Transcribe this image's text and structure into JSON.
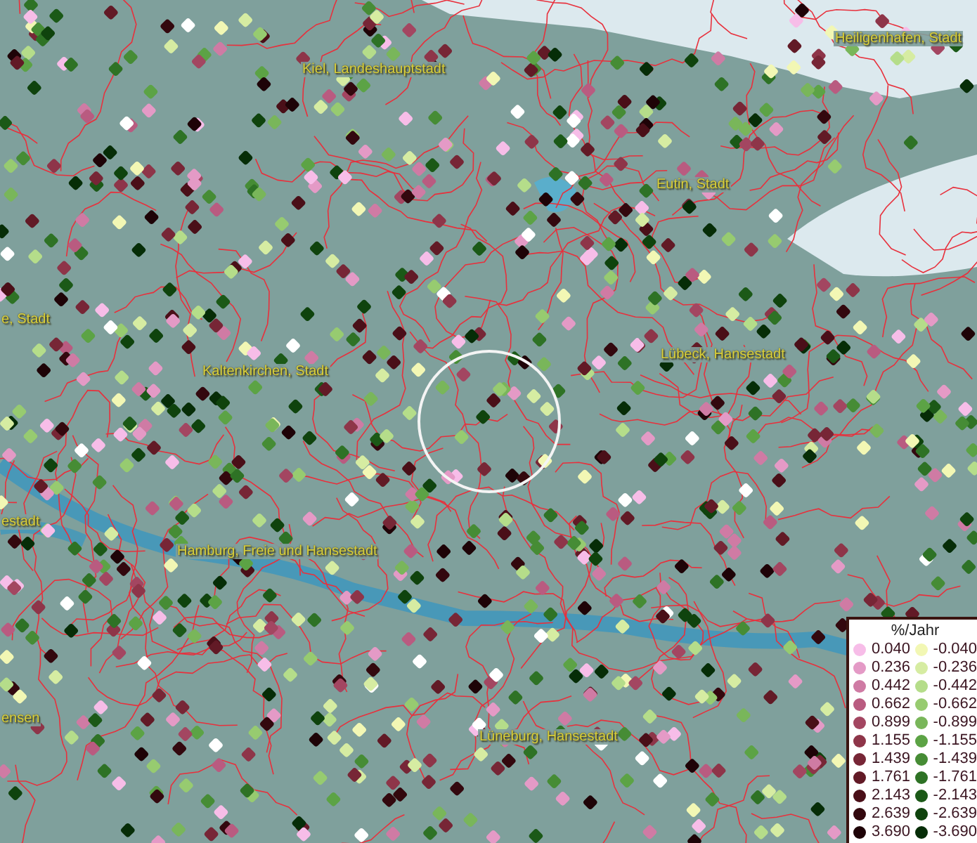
{
  "map": {
    "places": [
      {
        "label": "Kiel, Landeshauptstadt"
      },
      {
        "label": "Heiligenhafen, Stadt"
      },
      {
        "label": "Eutin, Stadt"
      },
      {
        "label": "e, Stadt"
      },
      {
        "label": "Kaltenkirchen, Stadt"
      },
      {
        "label": "Lübeck, Hansestadt"
      },
      {
        "label": "estadt"
      },
      {
        "label": "Hamburg, Freie und Hansestadt"
      },
      {
        "label": "ensen"
      },
      {
        "label": "Lüneburg, Hansestadt"
      }
    ]
  },
  "legend": {
    "title": "%/Jahr",
    "rows": [
      {
        "left": {
          "label": "0.040",
          "color": "#f7bde8"
        },
        "right": {
          "label": "-0.040",
          "color": "#f2f7b4"
        }
      },
      {
        "left": {
          "label": "0.236",
          "color": "#e49ac6"
        },
        "right": {
          "label": "-0.236",
          "color": "#d6eca2"
        }
      },
      {
        "left": {
          "label": "0.442",
          "color": "#cf7ba4"
        },
        "right": {
          "label": "-0.442",
          "color": "#b5dd8a"
        }
      },
      {
        "left": {
          "label": "0.662",
          "color": "#b95b80"
        },
        "right": {
          "label": "-0.662",
          "color": "#97cb70"
        }
      },
      {
        "left": {
          "label": "0.899",
          "color": "#a34661"
        },
        "right": {
          "label": "-0.899",
          "color": "#79b65a"
        }
      },
      {
        "left": {
          "label": "1.155",
          "color": "#8e3549"
        },
        "right": {
          "label": "-1.155",
          "color": "#5ca345"
        }
      },
      {
        "left": {
          "label": "1.439",
          "color": "#772636"
        },
        "right": {
          "label": "-1.439",
          "color": "#468c35"
        }
      },
      {
        "left": {
          "label": "1.761",
          "color": "#621a26"
        },
        "right": {
          "label": "-1.761",
          "color": "#2e7225"
        }
      },
      {
        "left": {
          "label": "2.143",
          "color": "#4a0f18"
        },
        "right": {
          "label": "-2.143",
          "color": "#1b5917"
        }
      },
      {
        "left": {
          "label": "2.639",
          "color": "#33080e"
        },
        "right": {
          "label": "-2.639",
          "color": "#0f430d"
        }
      },
      {
        "left": {
          "label": "3.690",
          "color": "#1e0307"
        },
        "right": {
          "label": "-3.690",
          "color": "#062d07"
        }
      }
    ]
  }
}
